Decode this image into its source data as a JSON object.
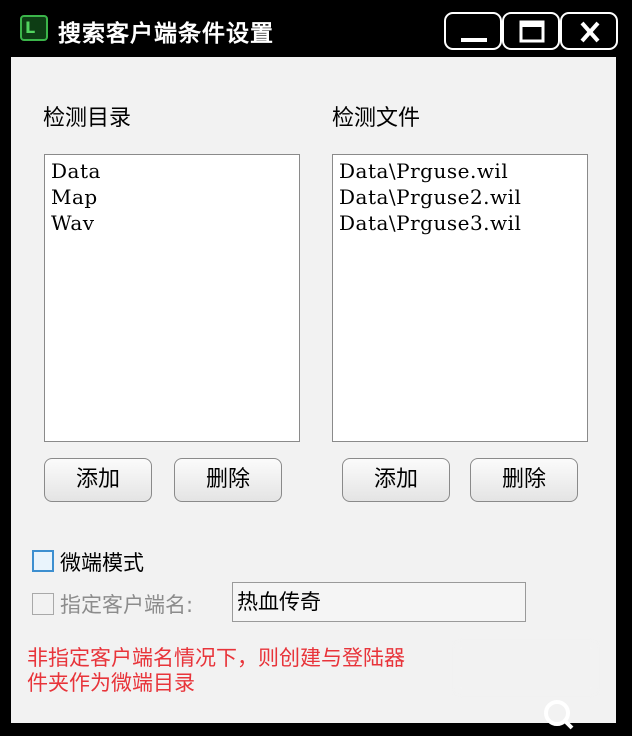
{
  "window": {
    "title": "搜索客户端条件设置",
    "icon": "app-logo-icon",
    "controls": [
      "minimize-icon",
      "maximize-icon",
      "close-icon"
    ]
  },
  "directories": {
    "label": "检测目录",
    "items": [
      "Data",
      "Map",
      "Wav"
    ],
    "add_label": "添加",
    "delete_label": "删除"
  },
  "files": {
    "label": "检测文件",
    "items": [
      "Data\\Prguse.wil",
      "Data\\Prguse2.wil",
      "Data\\Prguse3.wil"
    ],
    "add_label": "添加",
    "delete_label": "删除"
  },
  "micro_mode": {
    "label": "微端模式",
    "checked": false
  },
  "client_name": {
    "label": "指定客户端名:",
    "value": "热血传奇",
    "checked": false
  },
  "note": {
    "line1": "非指定客户端名情况下，则创建与登陆器",
    "line2": "件夹作为微端目录"
  },
  "colors": {
    "titlebar": "#000000",
    "client_bg": "#f2f2f2",
    "note": "#e8343a",
    "checkbox_accent": "#3d8fd0"
  }
}
